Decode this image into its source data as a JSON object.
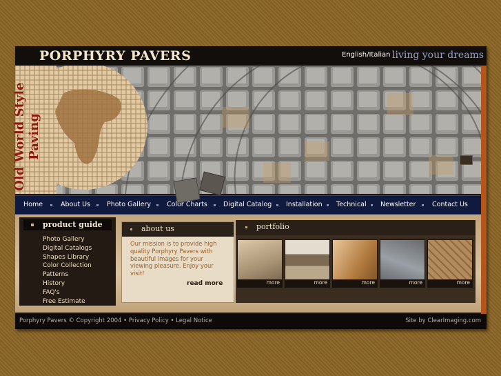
{
  "header": {
    "logo": "PORPHYRY PAVERS",
    "language_link": "English/Italian",
    "slogan": "living your dreams"
  },
  "hero": {
    "vertical_text": "Old World Style Paving",
    "image": "cobblestone-fan-pattern-with-mosaic-globe"
  },
  "nav": {
    "items": [
      "Home",
      "About Us",
      "Photo Gallery",
      "Color Charts",
      "Digital Catalog",
      "Installation",
      "Technical",
      "Newsletter",
      "Contact Us"
    ]
  },
  "product_guide": {
    "title": "product guide",
    "items": [
      "Photo Gallery",
      "Digital Catalogs",
      "Shapes Library",
      "Color Collection",
      "Patterns",
      "History",
      "FAQ's",
      "Free Estimate"
    ]
  },
  "about": {
    "title": "about us",
    "text": "Our mission is to provide high quality Porphyry Pavers with beautiful images for your viewing pleasure. Enjoy your visit!",
    "read_more": "read more"
  },
  "portfolio": {
    "title": "portfolio",
    "thumbnails": [
      {
        "more": "more",
        "image": "paved-plaza"
      },
      {
        "more": "more",
        "image": "arcade-street"
      },
      {
        "more": "more",
        "image": "interior-floor"
      },
      {
        "more": "more",
        "image": "worker-installing"
      },
      {
        "more": "more",
        "image": "paver-closeup"
      }
    ]
  },
  "footer": {
    "left": "Porphyry Pavers © Copyright 2004 • Privacy Policy • Legal Notice",
    "right": "Site by ClearImaging.com"
  },
  "colors": {
    "background": "#8a6526",
    "nav": "#101a3e",
    "accent_red": "#8b1a10",
    "slogan": "#9aa3c9"
  }
}
